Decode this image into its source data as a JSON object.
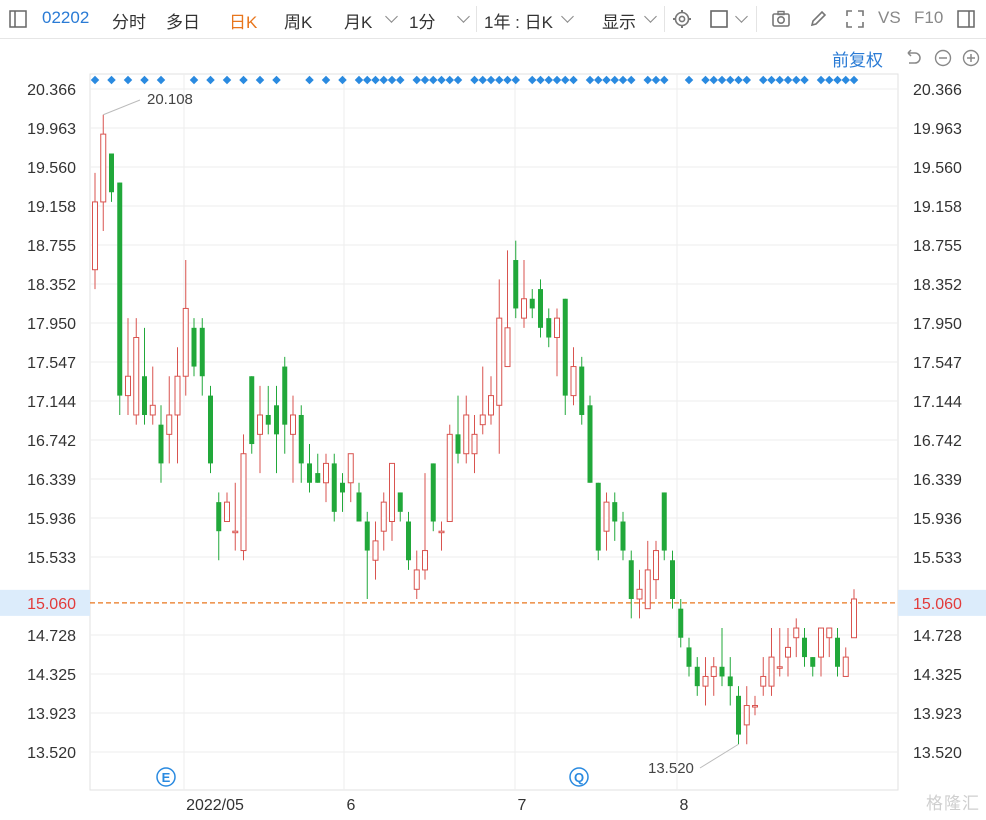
{
  "toolbar": {
    "code": "02202",
    "tabs": [
      "分时",
      "多日",
      "日K",
      "周K",
      "月K"
    ],
    "active_tab": "日K",
    "minute_select": "1分",
    "range_select": "1年 : 日K",
    "display_select": "显示",
    "vs_label": "VS",
    "f10_label": "F10",
    "fq_label": "前复权"
  },
  "watermark": "格隆汇",
  "colors": {
    "up": "#d9534f",
    "down": "#21a83a",
    "current": "#e8761d",
    "accent": "#2a7bd5"
  },
  "chart_data": {
    "type": "candlestick",
    "y_ticks": [
      "20.366",
      "19.963",
      "19.560",
      "19.158",
      "18.755",
      "18.352",
      "17.950",
      "17.547",
      "17.144",
      "16.742",
      "16.339",
      "15.936",
      "15.533",
      "15.060",
      "14.728",
      "14.325",
      "13.923",
      "13.520"
    ],
    "y_range": [
      13.52,
      20.366
    ],
    "x_ticks": [
      "2022/05",
      "6",
      "7",
      "8"
    ],
    "current_price": "15.060",
    "max_label": "20.108",
    "min_label": "13.520",
    "event_markers": [
      "E",
      "Q"
    ],
    "candles": [
      [
        18.5,
        19.2,
        19.5,
        18.3
      ],
      [
        19.2,
        19.9,
        20.1,
        18.9
      ],
      [
        19.7,
        19.3,
        19.7,
        19.2
      ],
      [
        19.4,
        17.2,
        19.4,
        17.0
      ],
      [
        17.2,
        17.4,
        18.0,
        17.0
      ],
      [
        17.0,
        17.8,
        18.0,
        16.9
      ],
      [
        17.4,
        17.0,
        17.9,
        16.9
      ],
      [
        17.0,
        17.1,
        17.5,
        16.9
      ],
      [
        16.9,
        16.5,
        17.1,
        16.3
      ],
      [
        16.8,
        17.0,
        17.4,
        16.5
      ],
      [
        17.0,
        17.4,
        17.7,
        16.5
      ],
      [
        17.4,
        18.1,
        18.6,
        17.2
      ],
      [
        17.9,
        17.5,
        18.0,
        17.4
      ],
      [
        17.9,
        17.4,
        18.0,
        17.2
      ],
      [
        17.2,
        16.5,
        17.3,
        16.4
      ],
      [
        16.1,
        15.8,
        16.2,
        15.5
      ],
      [
        15.9,
        16.1,
        16.2,
        15.9
      ],
      [
        15.8,
        15.8,
        16.3,
        15.6
      ],
      [
        15.6,
        16.6,
        16.8,
        15.5
      ],
      [
        17.4,
        16.7,
        17.4,
        16.6
      ],
      [
        16.8,
        17.0,
        17.3,
        16.4
      ],
      [
        17.0,
        16.9,
        17.3,
        16.8
      ],
      [
        17.1,
        16.8,
        17.3,
        16.4
      ],
      [
        17.5,
        16.9,
        17.6,
        16.6
      ],
      [
        16.8,
        17.0,
        17.2,
        16.3
      ],
      [
        17.0,
        16.5,
        17.1,
        16.3
      ],
      [
        16.5,
        16.3,
        16.7,
        16.2
      ],
      [
        16.4,
        16.3,
        16.6,
        16.3
      ],
      [
        16.3,
        16.5,
        16.6,
        16.1
      ],
      [
        16.5,
        16.0,
        16.6,
        15.9
      ],
      [
        16.3,
        16.2,
        16.4,
        16.0
      ],
      [
        16.3,
        16.6,
        16.6,
        16.1
      ],
      [
        16.2,
        15.9,
        16.3,
        15.9
      ],
      [
        15.9,
        15.6,
        16.0,
        15.1
      ],
      [
        15.5,
        15.7,
        15.9,
        15.3
      ],
      [
        15.8,
        16.1,
        16.2,
        15.6
      ],
      [
        15.9,
        16.5,
        16.5,
        15.7
      ],
      [
        16.2,
        16.0,
        16.2,
        15.9
      ],
      [
        15.9,
        15.5,
        16.0,
        15.4
      ],
      [
        15.2,
        15.4,
        15.6,
        15.1
      ],
      [
        15.4,
        15.6,
        16.4,
        15.3
      ],
      [
        16.5,
        15.9,
        16.5,
        15.8
      ],
      [
        15.8,
        15.8,
        15.9,
        15.6
      ],
      [
        15.9,
        16.8,
        16.9,
        15.9
      ],
      [
        16.8,
        16.6,
        17.2,
        16.5
      ],
      [
        16.6,
        17.0,
        17.2,
        16.5
      ],
      [
        16.6,
        16.8,
        17.0,
        16.4
      ],
      [
        16.9,
        17.0,
        17.5,
        16.8
      ],
      [
        17.0,
        17.2,
        17.4,
        16.9
      ],
      [
        17.1,
        18.0,
        18.4,
        16.6
      ],
      [
        17.5,
        17.9,
        18.7,
        17.5
      ],
      [
        18.6,
        18.1,
        18.8,
        18.0
      ],
      [
        18.0,
        18.2,
        18.6,
        17.9
      ],
      [
        18.2,
        18.1,
        18.3,
        18.0
      ],
      [
        18.3,
        17.9,
        18.4,
        17.8
      ],
      [
        18.0,
        17.8,
        18.1,
        17.7
      ],
      [
        17.8,
        18.0,
        18.1,
        17.4
      ],
      [
        18.2,
        17.2,
        18.2,
        17.0
      ],
      [
        17.2,
        17.5,
        17.7,
        17.1
      ],
      [
        17.5,
        17.0,
        17.6,
        16.9
      ],
      [
        17.1,
        16.3,
        17.2,
        16.3
      ],
      [
        16.3,
        15.6,
        16.3,
        15.5
      ],
      [
        15.8,
        16.1,
        16.2,
        15.6
      ],
      [
        16.1,
        15.9,
        16.2,
        15.7
      ],
      [
        15.9,
        15.6,
        16.0,
        15.5
      ],
      [
        15.5,
        15.1,
        15.6,
        14.9
      ],
      [
        15.1,
        15.2,
        15.4,
        14.9
      ],
      [
        15.0,
        15.4,
        15.7,
        15.0
      ],
      [
        15.3,
        15.6,
        15.7,
        15.1
      ],
      [
        16.2,
        15.6,
        16.2,
        15.5
      ],
      [
        15.5,
        15.1,
        15.6,
        15.0
      ],
      [
        15.0,
        14.7,
        15.1,
        14.6
      ],
      [
        14.6,
        14.4,
        14.7,
        14.3
      ],
      [
        14.4,
        14.2,
        14.5,
        14.1
      ],
      [
        14.2,
        14.3,
        14.5,
        14.0
      ],
      [
        14.3,
        14.4,
        14.5,
        14.1
      ],
      [
        14.4,
        14.3,
        14.8,
        14.2
      ],
      [
        14.3,
        14.2,
        14.5,
        14.0
      ],
      [
        14.1,
        13.7,
        14.2,
        13.6
      ],
      [
        13.8,
        14.0,
        14.2,
        13.6
      ],
      [
        14.0,
        14.0,
        14.1,
        13.9
      ],
      [
        14.2,
        14.3,
        14.5,
        14.1
      ],
      [
        14.2,
        14.5,
        14.8,
        14.1
      ],
      [
        14.4,
        14.4,
        14.8,
        14.3
      ],
      [
        14.5,
        14.6,
        14.8,
        14.3
      ],
      [
        14.7,
        14.8,
        14.9,
        14.5
      ],
      [
        14.7,
        14.5,
        14.8,
        14.4
      ],
      [
        14.5,
        14.4,
        14.5,
        14.3
      ],
      [
        14.5,
        14.8,
        14.8,
        14.3
      ],
      [
        14.7,
        14.8,
        14.8,
        14.5
      ],
      [
        14.7,
        14.4,
        14.8,
        14.3
      ],
      [
        14.3,
        14.5,
        14.6,
        14.3
      ],
      [
        14.7,
        15.1,
        15.2,
        14.7
      ]
    ]
  }
}
